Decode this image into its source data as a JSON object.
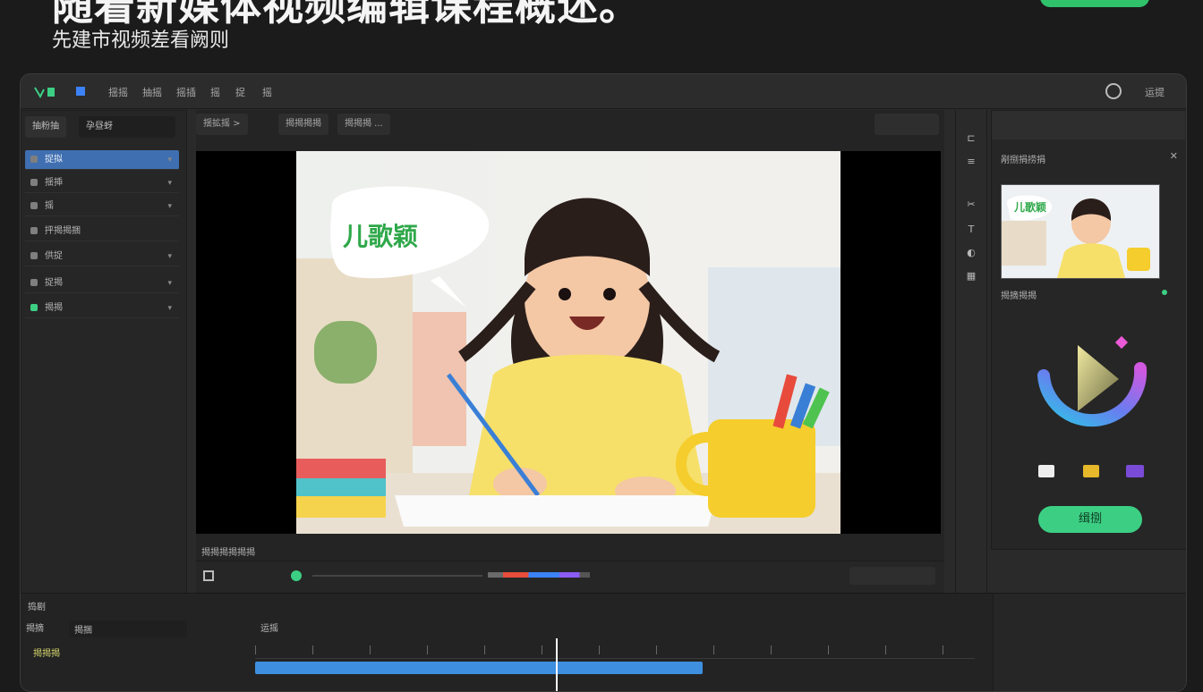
{
  "hero": {
    "title": "随着新媒体视频编辑课程概述。",
    "subtitle": "先建市视频差看阙则"
  },
  "menubar": {
    "items": [
      "揺摇",
      "抽摇",
      "摇插",
      "摇",
      "捉",
      "摇"
    ],
    "right_items": [
      "运提"
    ]
  },
  "left_panel": {
    "tabs": [
      "抽粉抽",
      "孕昼蚜"
    ],
    "tree": [
      {
        "label": "捉拟",
        "selected": true
      },
      {
        "label": "揺揷"
      },
      {
        "label": "摇"
      },
      {
        "label": "抨揭揭捆"
      },
      {
        "label": "供捉"
      },
      {
        "label": "捉揭"
      },
      {
        "label": "揭揭"
      }
    ]
  },
  "viewer": {
    "toolbar_left": "揺拡摇  >",
    "toolbar_mid": "揭揭揭揭",
    "toolbar_mid2": "揭揭揭 ...",
    "speech_bubble": "儿歌颖",
    "status": "揭揭揭揭揭揭"
  },
  "right_panel": {
    "header": "剐捌捐捞捐",
    "thumb_caption": "儿歌颖",
    "thumb_row_label": "揭摘揭揭",
    "export_label": "缉捌"
  },
  "timeline": {
    "title": "捣剧",
    "row1_label": "揭摘",
    "row1_value": "揭捆",
    "row2_label": "揭揭揭",
    "tab": "运摇"
  },
  "colors": {
    "accent_green": "#3ccf84",
    "selection_blue": "#3f6fb0",
    "track_blue": "#3e8fe0"
  }
}
